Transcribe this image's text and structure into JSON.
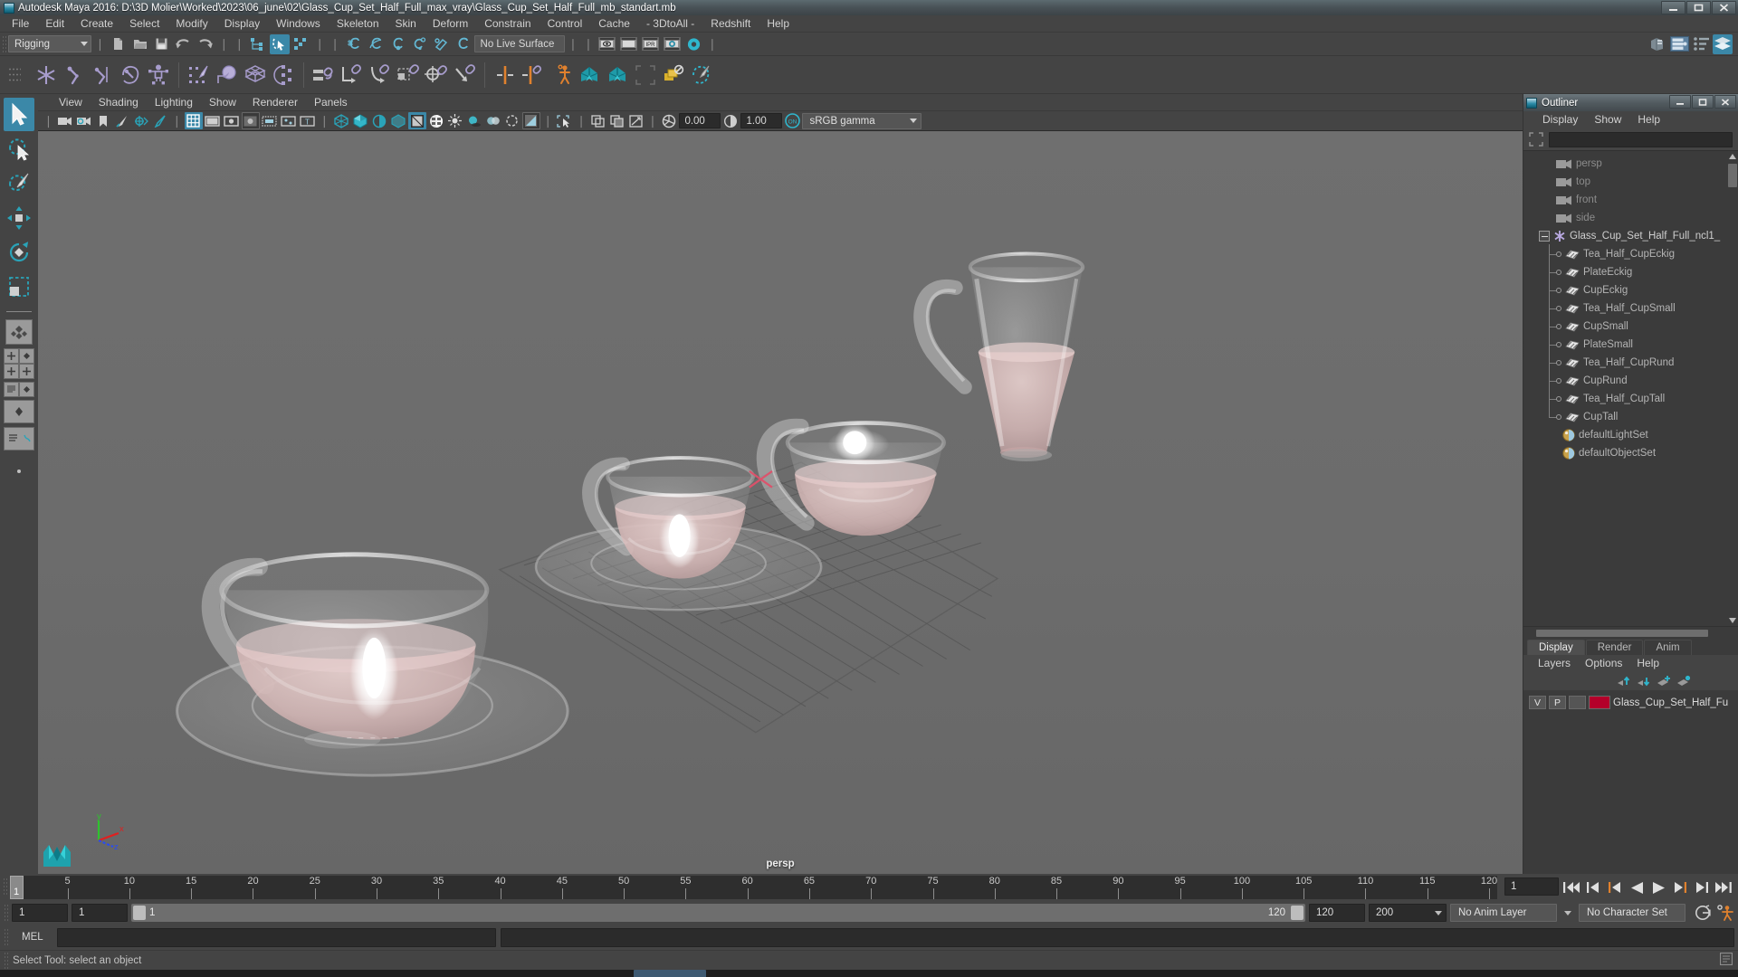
{
  "window": {
    "title": "Autodesk Maya 2016: D:\\3D Molier\\Worked\\2023\\06_june\\02\\Glass_Cup_Set_Half_Full_max_vray\\Glass_Cup_Set_Half_Full_mb_standart.mb",
    "minimize": "—",
    "maximize": "□",
    "close": "✕",
    "app_icon": "maya-icon"
  },
  "menubar": {
    "items": [
      "File",
      "Edit",
      "Create",
      "Select",
      "Modify",
      "Display",
      "Windows",
      "Skeleton",
      "Skin",
      "Deform",
      "Constrain",
      "Control",
      "Cache",
      "- 3DtoAll -",
      "Redshift",
      "Help"
    ]
  },
  "statusline": {
    "mode": "Rigging",
    "live_surface": "No Live Surface",
    "icons": [
      "new-scene-icon",
      "open-scene-icon",
      "save-scene-icon",
      "undo-icon",
      "redo-icon",
      "select-by-hierarchy-icon",
      "select-by-object-icon",
      "select-by-component-icon",
      "snap-grid-icon",
      "snap-curve-icon",
      "snap-point-icon",
      "snap-projected-center-icon",
      "snap-view-plane-icon",
      "snap-make-live-icon",
      "render-view-icon",
      "render-region-icon",
      "ipr-render-icon",
      "render-settings-icon",
      "hypershade-icon"
    ],
    "right_icons": [
      "show-hide-editors-icon",
      "attribute-editor-icon",
      "tool-settings-icon",
      "channel-box-icon"
    ]
  },
  "shelf": {
    "items": [
      "joint-tool-icon",
      "ik-handle-icon",
      "ik-spline-handle-icon",
      "insert-joint-icon",
      "quick-rig-icon",
      "paint-skin-weights-icon",
      "bind-skin-icon",
      "lattice-deformer-icon",
      "cluster-deformer-icon",
      "parent-constraint-icon",
      "point-constraint-icon",
      "orient-constraint-icon",
      "scale-constraint-icon",
      "aim-constraint-icon",
      "pole-vector-constraint-icon",
      "mirror-joint-icon",
      "mirror-skin-weights-icon",
      "human-ik-icon",
      "character-set-icon",
      "character-set-2-icon",
      "disable-deformers-icon",
      "paint-weights-icon"
    ]
  },
  "toolbox": {
    "tools": [
      {
        "name": "select-tool",
        "active": true
      },
      {
        "name": "lasso-select-tool",
        "active": false
      },
      {
        "name": "paint-select-tool",
        "active": false
      },
      {
        "name": "move-tool",
        "active": false
      },
      {
        "name": "rotate-tool",
        "active": false
      },
      {
        "name": "scale-tool",
        "active": false
      }
    ],
    "layout_presets": [
      "single-perspective-layout",
      "four-view-layout",
      "persp-outliner-layout",
      "persp-graph-editor-layout",
      "hypershade-persp-layout"
    ]
  },
  "viewport": {
    "menus": [
      "View",
      "Shading",
      "Lighting",
      "Show",
      "Renderer",
      "Panels"
    ],
    "toolbar_icons": [
      "select-camera-icon",
      "camera-attributes-icon",
      "bookmark-icon",
      "image-plane-icon",
      "2d-pan-zoom-icon",
      "grease-pencil-icon",
      "grid-toggle-icon",
      "film-gate-icon",
      "resolution-gate-icon",
      "gate-mask-icon",
      "film-origin-icon",
      "safe-action-icon",
      "safe-title-icon",
      "wireframe-icon",
      "smooth-shade-all-icon",
      "smooth-shade-selected-icon",
      "flat-shade-icon",
      "shaded-wireframe-icon",
      "textured-icon",
      "lighting-icon",
      "shadows-icon",
      "screen-space-ao-icon",
      "motion-blur-icon",
      "multisample-aa-icon",
      "isolate-select-icon",
      "xray-icon",
      "xray-joints-icon",
      "xray-active-components-icon",
      "exposure-icon",
      "gamma-icon",
      "view-transform-icon"
    ],
    "exposure": "0.00",
    "gamma": "1.00",
    "color_management": "sRGB gamma",
    "camera_label": "persp",
    "axis_labels": {
      "x": "x",
      "y": "y",
      "z": "z"
    }
  },
  "outliner": {
    "panel_title": "Outliner",
    "menus": [
      "Display",
      "Show",
      "Help"
    ],
    "search_value": "",
    "tree": [
      {
        "label": "persp",
        "type": "camera",
        "level": 1,
        "dim": true
      },
      {
        "label": "top",
        "type": "camera",
        "level": 1,
        "dim": true
      },
      {
        "label": "front",
        "type": "camera",
        "level": 1,
        "dim": true
      },
      {
        "label": "side",
        "type": "camera",
        "level": 1,
        "dim": true
      },
      {
        "label": "Glass_Cup_Set_Half_Full_ncl1_",
        "type": "group",
        "level": 0,
        "dim": false,
        "expanded": true
      },
      {
        "label": "Tea_Half_CupEckig",
        "type": "mesh",
        "level": 2,
        "dim": false
      },
      {
        "label": "PlateEckig",
        "type": "mesh",
        "level": 2,
        "dim": false
      },
      {
        "label": "CupEckig",
        "type": "mesh",
        "level": 2,
        "dim": false
      },
      {
        "label": "Tea_Half_CupSmall",
        "type": "mesh",
        "level": 2,
        "dim": false
      },
      {
        "label": "CupSmall",
        "type": "mesh",
        "level": 2,
        "dim": false
      },
      {
        "label": "PlateSmall",
        "type": "mesh",
        "level": 2,
        "dim": false
      },
      {
        "label": "Tea_Half_CupRund",
        "type": "mesh",
        "level": 2,
        "dim": false
      },
      {
        "label": "CupRund",
        "type": "mesh",
        "level": 2,
        "dim": false
      },
      {
        "label": "Tea_Half_CupTall",
        "type": "mesh",
        "level": 2,
        "dim": false
      },
      {
        "label": "CupTall",
        "type": "mesh",
        "level": 2,
        "dim": false,
        "last": true
      },
      {
        "label": "defaultLightSet",
        "type": "set",
        "level": 1,
        "dim": false
      },
      {
        "label": "defaultObjectSet",
        "type": "set",
        "level": 1,
        "dim": false
      }
    ]
  },
  "layer_editor": {
    "tabs": [
      {
        "label": "Display",
        "active": true
      },
      {
        "label": "Render",
        "active": false
      },
      {
        "label": "Anim",
        "active": false
      }
    ],
    "menus": [
      "Layers",
      "Options",
      "Help"
    ],
    "buttons": [
      "move-layer-up-icon",
      "move-layer-down-icon",
      "new-layer-icon",
      "new-layer-from-selected-icon"
    ],
    "layers": [
      {
        "visibility": "V",
        "playback": "P",
        "shading": "",
        "color": "#b4002a",
        "name": "Glass_Cup_Set_Half_Fu"
      }
    ]
  },
  "timeslider": {
    "current_frame": "1",
    "start_label": "1",
    "ticks": [
      5,
      10,
      15,
      20,
      25,
      30,
      35,
      40,
      45,
      50,
      55,
      60,
      65,
      70,
      75,
      80,
      85,
      90,
      95,
      100,
      105,
      110,
      115,
      120
    ],
    "range_start": 1,
    "range_end": 120,
    "playback_buttons": [
      "go-to-start-icon",
      "step-back-frame-icon",
      "step-back-key-icon",
      "play-backwards-icon",
      "play-forwards-icon",
      "step-forward-key-icon",
      "step-forward-frame-icon",
      "go-to-end-icon"
    ]
  },
  "rangeslider": {
    "anim_start": "1",
    "playback_start": "1",
    "bar_start_label": "1",
    "bar_end_label": "120",
    "playback_end": "120",
    "anim_end": "200",
    "anim_layer": "No Anim Layer",
    "character_set": "No Character Set",
    "auto_key_icon": "auto-keyframe-icon",
    "anim_prefs_icon": "animation-preferences-icon"
  },
  "commandline": {
    "language": "MEL",
    "input_value": "",
    "output_value": ""
  },
  "helpline": {
    "text": "Select Tool: select an object"
  },
  "colors": {
    "accent_blue": "#3b88a8",
    "panel_bg": "#444444",
    "viewport_bg": "#6e6e6e",
    "tree_bg": "#3b3b3b",
    "layer_color": "#b4002a",
    "orange": "#e0812e",
    "shelf_purple": "#a79ccc"
  }
}
